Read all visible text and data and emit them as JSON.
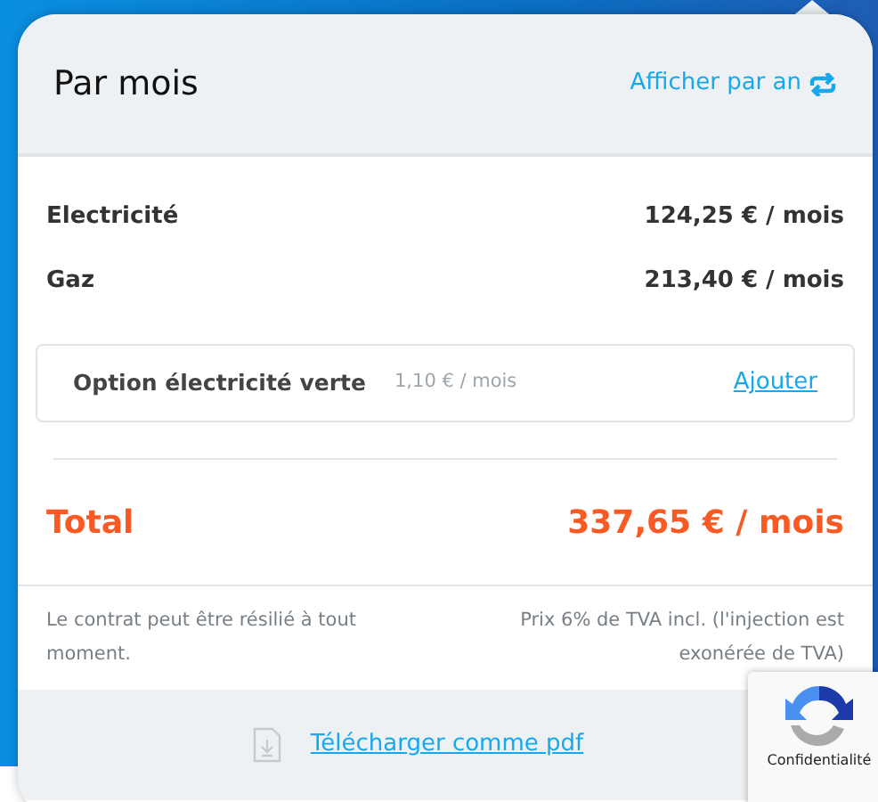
{
  "header": {
    "title": "Par mois",
    "toggle_link": "Afficher par an"
  },
  "lines": [
    {
      "label": "Electricité",
      "amount": "124,25 € / mois"
    },
    {
      "label": "Gaz",
      "amount": "213,40 € / mois"
    }
  ],
  "option": {
    "label": "Option électricité verte",
    "price": "1,10 € / mois",
    "action": "Ajouter"
  },
  "total": {
    "label": "Total",
    "amount": "337,65 € / mois"
  },
  "notes": {
    "left": "Le contrat peut être résilié à tout moment.",
    "right": "Prix 6% de TVA incl. (l'injection est exonérée de TVA)"
  },
  "footer": {
    "download_link": "Télécharger comme pdf"
  },
  "recaptcha": {
    "label": "Confidentialité"
  }
}
